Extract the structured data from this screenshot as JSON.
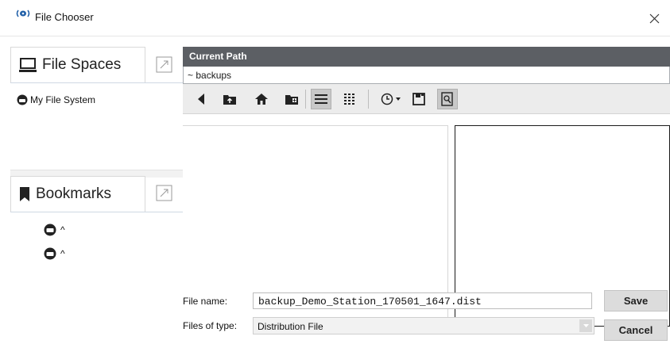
{
  "window": {
    "title": "File Chooser",
    "close_glyph": "✕",
    "icon": "app-logo-icon"
  },
  "file_spaces": {
    "title": "File Spaces",
    "icon": "monitor-icon",
    "items": [
      {
        "label": "My File System",
        "icon": "drive-icon"
      }
    ]
  },
  "bookmarks": {
    "title": "Bookmarks",
    "icon": "bookmark-icon",
    "items": [
      {
        "label": "^",
        "icon": "drive-icon"
      },
      {
        "label": "^",
        "icon": "drive-icon"
      }
    ]
  },
  "current_path": {
    "header": "Current Path",
    "value": "~ backups"
  },
  "toolbar": {
    "buttons": [
      "back-icon",
      "up-folder-icon",
      "home-icon",
      "new-folder-icon",
      "list-view-icon",
      "details-view-icon",
      "history-icon",
      "history-dropdown-icon",
      "save-icon",
      "preview-icon"
    ],
    "active_view": "list-view-icon"
  },
  "form": {
    "file_name_label": "File name:",
    "file_name_value": "backup_Demo_Station_170501_1647.dist",
    "file_type_label": "Files of type:",
    "file_type_value": "Distribution File",
    "save_label": "Save",
    "cancel_label": "Cancel"
  },
  "colors": {
    "path_header_bg": "#5c5f64",
    "button_bg": "#dcdcdc",
    "logo_blue": "#1f5fa8"
  }
}
